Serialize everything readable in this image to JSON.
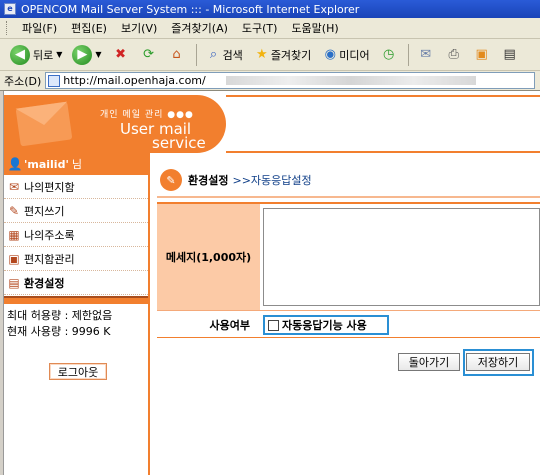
{
  "window": {
    "title": "OPENCOM Mail Server System ::: - Microsoft Internet Explorer",
    "app_icon": "e"
  },
  "menubar": {
    "items": [
      "파일(F)",
      "편집(E)",
      "보기(V)",
      "즐겨찾기(A)",
      "도구(T)",
      "도움말(H)"
    ]
  },
  "toolbar": {
    "back_label": "뒤로",
    "search_label": "검색",
    "favorites_label": "즐겨찾기",
    "media_label": "미디어"
  },
  "addressbar": {
    "label": "주소(D)",
    "url": "http://mail.openhaja.com/"
  },
  "header": {
    "subtitle": "개인 메일 관리 ●●●",
    "brand_line1": "User mail",
    "brand_line2": "service"
  },
  "sidebar": {
    "user": {
      "mailid": "'mailid'",
      "suffix": "님"
    },
    "items": [
      {
        "label": "나의편지함",
        "icon": "inbox-icon"
      },
      {
        "label": "편지쓰기",
        "icon": "pencil-icon"
      },
      {
        "label": "나의주소록",
        "icon": "addressbook-icon"
      },
      {
        "label": "편지함관리",
        "icon": "folder-manage-icon"
      },
      {
        "label": "환경설정",
        "icon": "settings-doc-icon"
      }
    ],
    "quota_max": "최대 허용량 : 제한없음",
    "quota_used": "현재 사용량 : 9996 K",
    "logout_label": "로그아웃"
  },
  "content": {
    "title_main": "환경설정",
    "title_sub": ">>자동응답설정",
    "message_label": "메세지(1,000자)",
    "message_value": "",
    "use_label": "사용여부",
    "use_checkbox_label": "자동응답기능 사용",
    "use_checked": false,
    "back_button": "돌아가기",
    "save_button": "저장하기"
  },
  "colors": {
    "accent": "#f27f2e",
    "label_bg": "#fccaa6",
    "highlight": "#2a8fd4"
  }
}
